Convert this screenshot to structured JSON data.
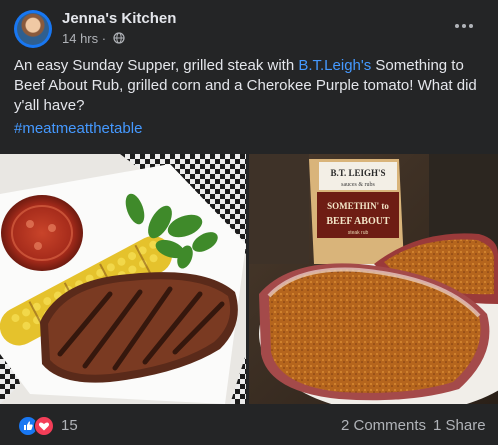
{
  "post": {
    "page_name": "Jenna's Kitchen",
    "time": "14 hrs",
    "separator": " · ",
    "visibility_icon": "globe-icon",
    "more_icon": "more-options-icon",
    "text_line1_pre": "An easy Sunday Supper, grilled steak with ",
    "text_mention": "B.T.Leigh's",
    "text_line1_post": " Something to",
    "text_line2": "Beef About Rub, grilled corn and a Cherokee Purple tomato!  What did",
    "text_line3": "y'all have?",
    "hashtag": "#meatmeatthetable"
  },
  "photos": {
    "left_alt": "Grilled steak with corn on the cob, tomato and basil on a white plate",
    "right_alt": "Raw steaks coated in rub next to a bag of seasoning",
    "product_brand": "B.T. LEIGH'S",
    "product_tagline": "sauces & rubs",
    "product_name_1": "SOMETHIN' to",
    "product_name_2": "BEEF ABOUT",
    "product_small": "steak rub"
  },
  "reactions": {
    "icons": [
      "like-reaction-icon",
      "love-reaction-icon"
    ],
    "count": "15",
    "comments": "2 Comments",
    "shares": "1 Share"
  },
  "colors": {
    "background": "#242526",
    "text": "#e4e6eb",
    "secondary_text": "#b0b3b8",
    "link": "#4599ff",
    "like": "#1877f2",
    "love": "#f33e58"
  }
}
